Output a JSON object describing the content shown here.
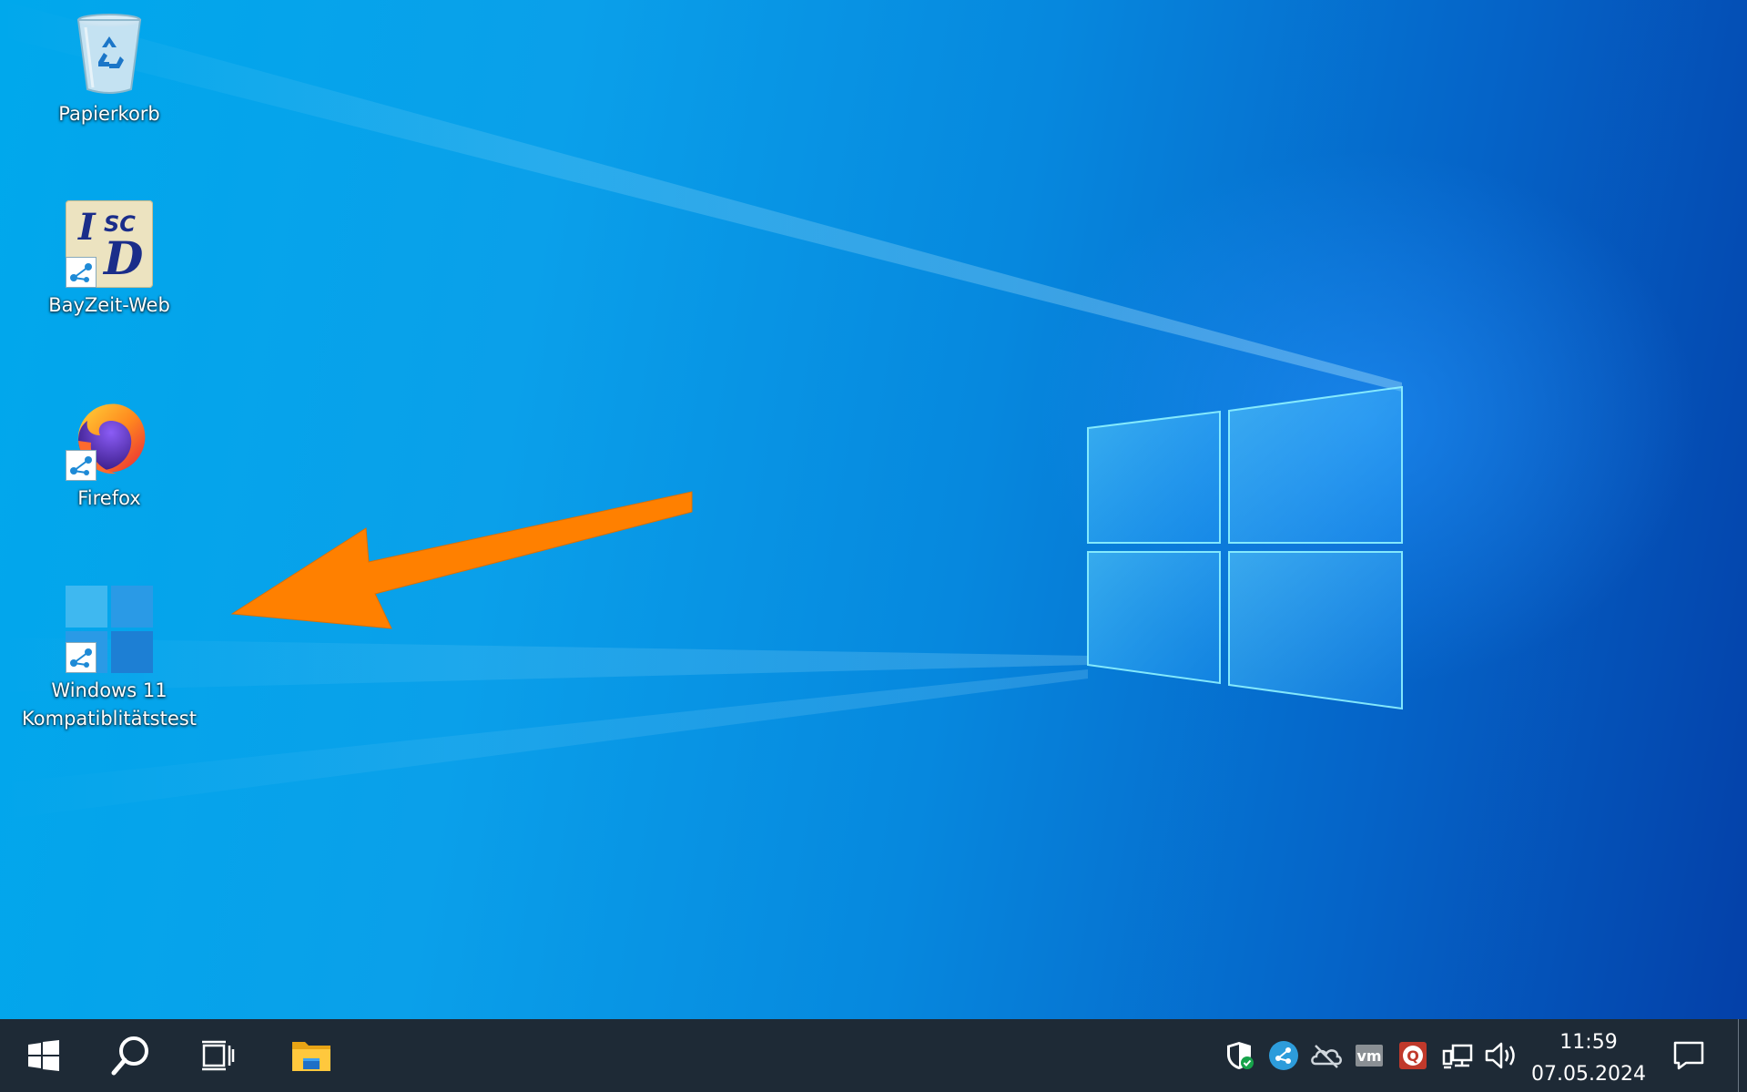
{
  "desktop": {
    "icons": [
      {
        "id": "recycle-bin",
        "label": "Papierkorb",
        "icon": "recycle-bin-icon"
      },
      {
        "id": "bayzeit-web",
        "label": "BayZeit-Web",
        "icon": "isc-d-logo-icon"
      },
      {
        "id": "firefox",
        "label": "Firefox",
        "icon": "firefox-icon"
      },
      {
        "id": "win11-check",
        "label_line1": "Windows 11",
        "label_line2": "Kompatiblitätstest",
        "icon": "windows-logo-icon"
      }
    ],
    "annotation_color": "#ff8000",
    "accent_colors": {
      "wallpaper_light": "#00a8ec",
      "wallpaper_dark": "#0440a8"
    }
  },
  "bayzeit_logo": {
    "top": "SC",
    "main": "D",
    "bar": "I"
  },
  "taskbar": {
    "background": "#1e2a36",
    "buttons": [
      "start-button",
      "search-button",
      "task-view-button",
      "file-explorer-button"
    ],
    "tray": [
      "windows-security-icon",
      "share-connector-icon",
      "onedrive-icon",
      "vmware-icon",
      "q-app-icon",
      "network-icon",
      "volume-icon"
    ],
    "tray_labels": {
      "vmware": "vm",
      "q_app": "Q"
    },
    "clock": {
      "time": "11:59",
      "date": "07.05.2024"
    },
    "notification": "action-center-icon"
  }
}
